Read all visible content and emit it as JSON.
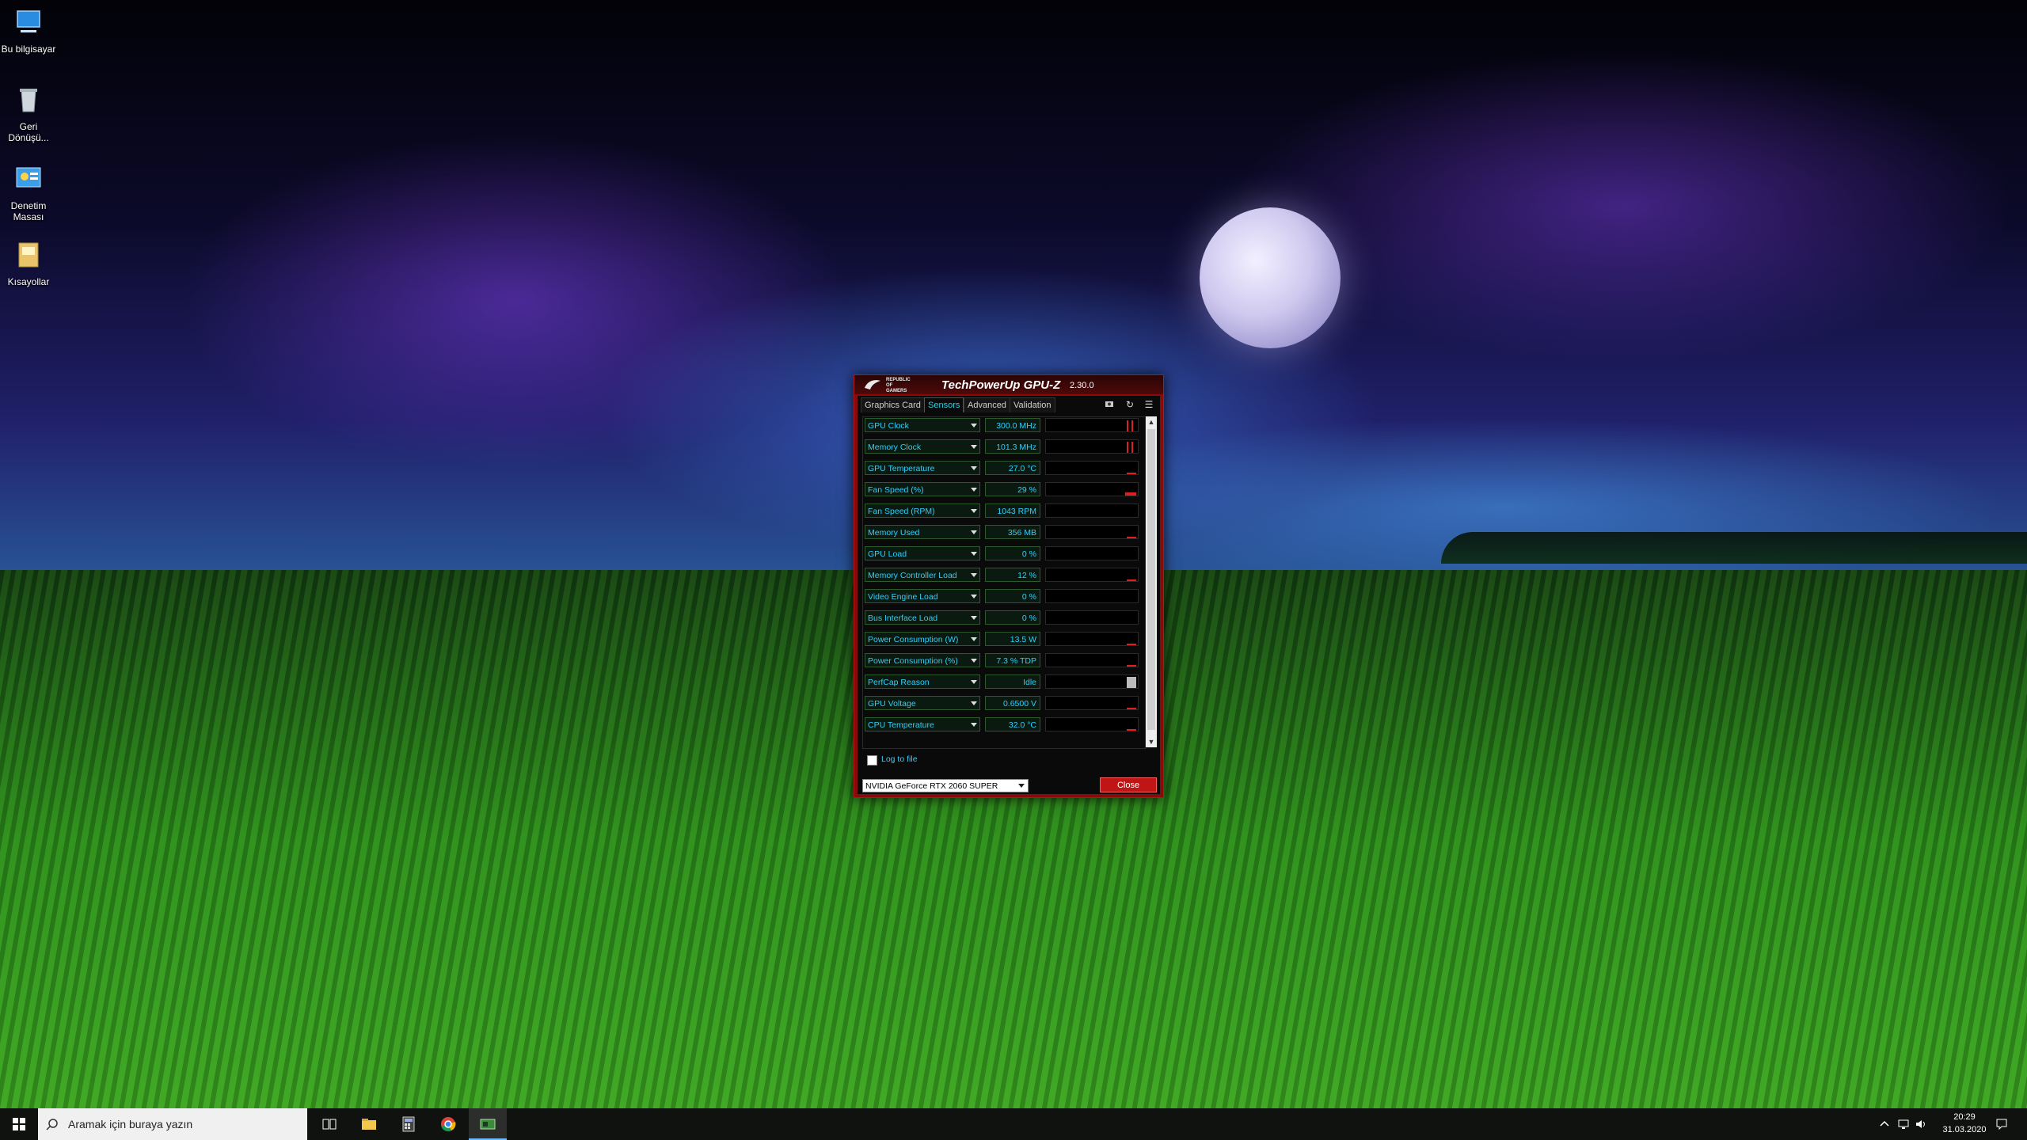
{
  "desktop": {
    "icons": [
      {
        "label": "Bu bilgisayar"
      },
      {
        "label": "Geri Dönüşü..."
      },
      {
        "label": "Denetim Masası"
      },
      {
        "label": "Kısayollar"
      }
    ]
  },
  "gpuz": {
    "brand_line1": "REPUBLIC OF",
    "brand_line2": "GAMERS",
    "app_name": "TechPowerUp GPU-Z",
    "version": "2.30.0",
    "tabs": [
      {
        "label": "Graphics Card"
      },
      {
        "label": "Sensors"
      },
      {
        "label": "Advanced"
      },
      {
        "label": "Validation"
      }
    ],
    "active_tab": "Sensors",
    "sensors": [
      {
        "name": "GPU Clock",
        "value": "300.0 MHz",
        "graph": "spikes"
      },
      {
        "name": "Memory Clock",
        "value": "101.3 MHz",
        "graph": "spikes"
      },
      {
        "name": "GPU Temperature",
        "value": "27.0 °C",
        "graph": "low"
      },
      {
        "name": "Fan Speed (%)",
        "value": "29 %",
        "graph": "mid"
      },
      {
        "name": "Fan Speed (RPM)",
        "value": "1043 RPM",
        "graph": "none"
      },
      {
        "name": "Memory Used",
        "value": "356 MB",
        "graph": "low"
      },
      {
        "name": "GPU Load",
        "value": "0 %",
        "graph": "none"
      },
      {
        "name": "Memory Controller Load",
        "value": "12 %",
        "graph": "low"
      },
      {
        "name": "Video Engine Load",
        "value": "0 %",
        "graph": "none"
      },
      {
        "name": "Bus Interface Load",
        "value": "0 %",
        "graph": "none"
      },
      {
        "name": "Power Consumption (W)",
        "value": "13.5 W",
        "graph": "low"
      },
      {
        "name": "Power Consumption (%)",
        "value": "7.3 % TDP",
        "graph": "low"
      },
      {
        "name": "PerfCap Reason",
        "value": "Idle",
        "graph": "gray"
      },
      {
        "name": "GPU Voltage",
        "value": "0.6500 V",
        "graph": "low"
      },
      {
        "name": "CPU Temperature",
        "value": "32.0 °C",
        "graph": "low"
      }
    ],
    "log_label": "Log to file",
    "log_checked": false,
    "gpu_selected": "NVIDIA GeForce RTX 2060 SUPER",
    "close_label": "Close"
  },
  "taskbar": {
    "search_placeholder": "Aramak için buraya yazın",
    "apps": [
      "task-view",
      "file-explorer",
      "calculator",
      "chrome",
      "gpu-z"
    ],
    "time": "20:29",
    "date": "31.03.2020"
  }
}
